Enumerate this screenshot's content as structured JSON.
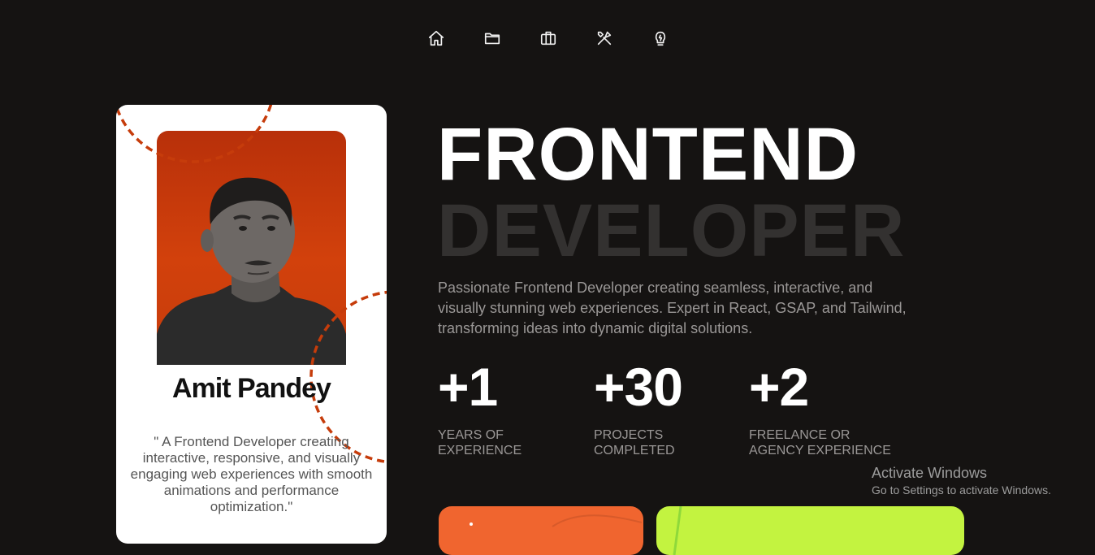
{
  "nav": {
    "items": [
      {
        "icon": "home-icon"
      },
      {
        "icon": "folder-icon"
      },
      {
        "icon": "briefcase-icon"
      },
      {
        "icon": "tools-icon"
      },
      {
        "icon": "lightbulb-icon"
      }
    ]
  },
  "profile": {
    "name": "Amit Pandey",
    "quote": "\" A Frontend Developer creating interactive, responsive, and visually engaging web experiences with smooth animations and performance optimization.\"",
    "accent_color": "#c63c0b"
  },
  "hero": {
    "title_line1": "FRONTEND",
    "title_line2": "DEVELOPER",
    "description": "Passionate Frontend Developer creating seamless, interactive, and visually stunning web experiences. Expert in React, GSAP, and Tailwind, transforming ideas into dynamic digital solutions."
  },
  "stats": [
    {
      "value": "+1",
      "label_line1": "YEARS OF",
      "label_line2": "EXPERIENCE"
    },
    {
      "value": "+30",
      "label_line1": "PROJECTS",
      "label_line2": "COMPLETED"
    },
    {
      "value": "+2",
      "label_line1": "FREELANCE OR",
      "label_line2": "AGENCY EXPERIENCE"
    }
  ],
  "cards": {
    "orange_color": "#f0652f",
    "lime_color": "#c3f340"
  },
  "watermark": {
    "title": "Activate Windows",
    "subtitle": "Go to Settings to activate Windows."
  }
}
